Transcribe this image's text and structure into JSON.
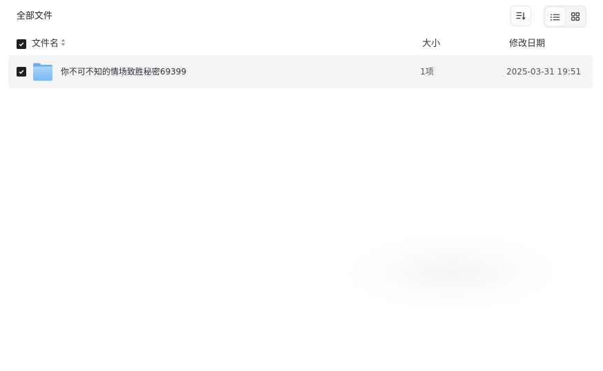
{
  "header": {
    "title": "全部文件",
    "sort_icon": "sort-icon",
    "view_modes": [
      {
        "name": "list",
        "icon": "list-view-icon",
        "active": true
      },
      {
        "name": "grid",
        "icon": "grid-view-icon",
        "active": false
      }
    ]
  },
  "table": {
    "columns": {
      "name": "文件名",
      "size": "大小",
      "date": "修改日期"
    },
    "select_all_checked": true,
    "rows": [
      {
        "checked": true,
        "icon": "folder-icon",
        "name": "你不可不知的情场致胜秘密69399",
        "size": "1项",
        "date": "2025-03-31 19:51"
      }
    ]
  },
  "colors": {
    "row_background": "#f4f4f5",
    "checkbox": "#1f1f1f",
    "folder": "#7ab8f5"
  }
}
